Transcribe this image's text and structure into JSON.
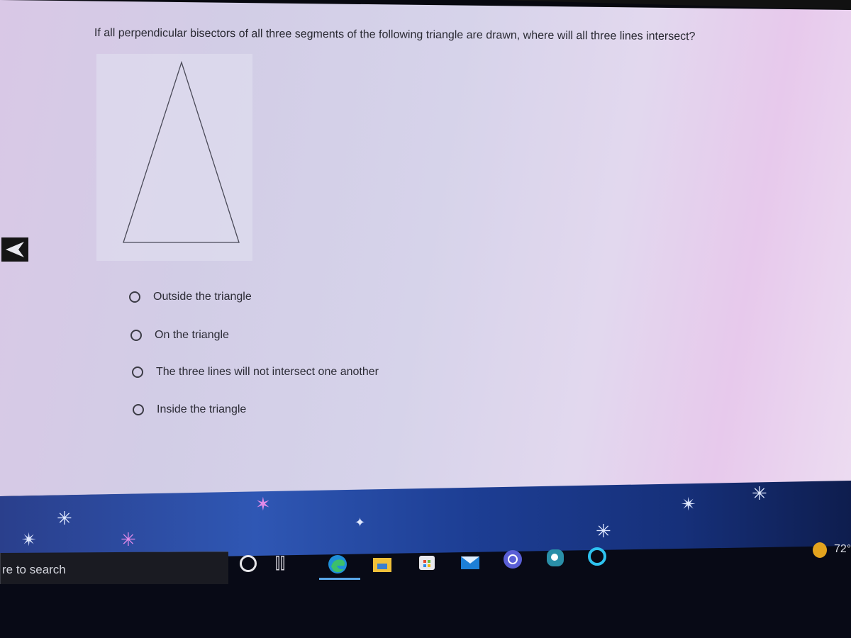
{
  "quiz": {
    "question": "If all perpendicular bisectors of all three segments of the following triangle are drawn, where will all three lines intersect?",
    "figure": "isosceles-triangle",
    "options": [
      {
        "label": "Outside the triangle",
        "selected": false
      },
      {
        "label": "On the triangle",
        "selected": false
      },
      {
        "label": "The three lines will not intersect one another",
        "selected": false
      },
      {
        "label": "Inside the triangle",
        "selected": false
      }
    ]
  },
  "navigation": {
    "back_icon": "back-arrow-icon"
  },
  "taskbar": {
    "search_text": "re to search",
    "apps": [
      "cortana",
      "task-view",
      "microsoft-edge",
      "file-explorer",
      "microsoft-store",
      "mail",
      "app",
      "search-app",
      "alexa"
    ],
    "weather": {
      "temperature": "72°"
    }
  },
  "colors": {
    "edge_accent": "#5aa7e8",
    "weather_sun": "#e3a31e",
    "taskbar_bg": "#080a16"
  }
}
